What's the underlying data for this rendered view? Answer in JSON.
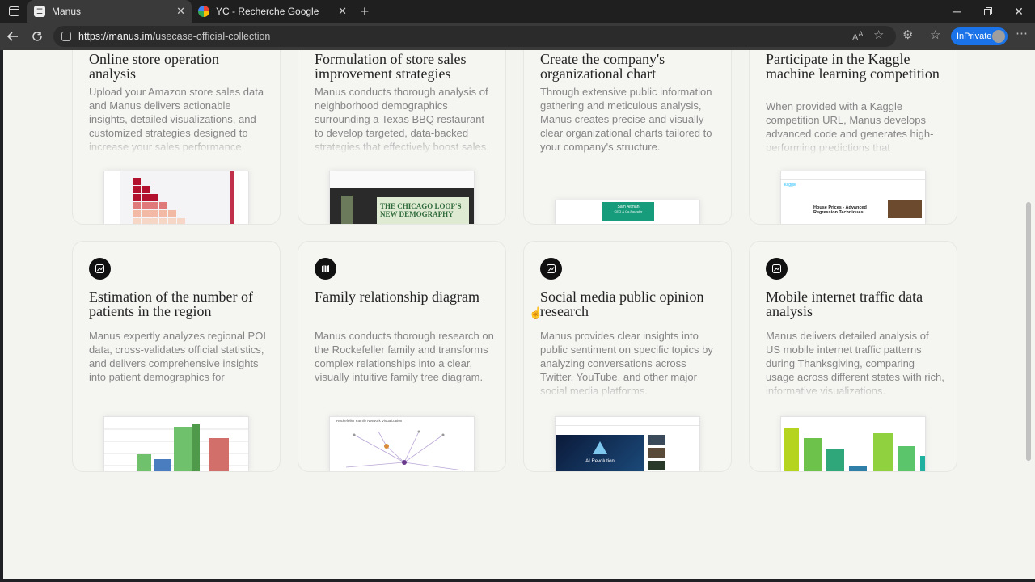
{
  "browser": {
    "tabs": [
      {
        "title": "Manus",
        "active": true
      },
      {
        "title": "YC - Recherche Google",
        "active": false
      }
    ],
    "url_domain": "https://manus.im",
    "url_path": "/usecase-official-collection",
    "inprivate_label": "InPrivate",
    "new_tab_symbol": "+"
  },
  "cards_row1": [
    {
      "title": "Online store operation analysis",
      "desc": "Upload your Amazon store sales data and Manus delivers actionable insights, detailed visualizations, and customized strategies designed to increase your sales performance.",
      "thumb": "heatmap-chart"
    },
    {
      "title": "Formulation of store sales improvement strategies",
      "desc": "Manus conducts thorough analysis of neighborhood demographics surrounding a Texas BBQ restaurant to develop targeted, data-backed strategies that effectively boost sales.",
      "thumb": "chicago-demography",
      "thumb_text": "THE CHICAGO LOOP'S NEW DEMOGRAPHY"
    },
    {
      "title": "Create the company's organizational chart",
      "desc": "Through extensive public information gathering and meticulous analysis, Manus creates precise and visually clear organizational charts tailored to your company's structure.",
      "thumb": "org-chart",
      "thumb_text": "Sam Altman",
      "thumb_subtext": "CEO & Co-Founder"
    },
    {
      "title": "Participate in the Kaggle machine learning competition",
      "desc": "When provided with a Kaggle competition URL, Manus develops advanced code and generates high-performing predictions that",
      "thumb": "kaggle-page",
      "thumb_text": "House Prices - Advanced Regression Techniques",
      "thumb_logo": "kaggle"
    }
  ],
  "cards_row2": [
    {
      "title": "Estimation of the number of patients in the region",
      "desc": "Manus expertly analyzes regional POI data, cross-validates official statistics, and delivers comprehensive insights into patient demographics for",
      "icon": "chart-icon",
      "thumb": "3d-bar-chart"
    },
    {
      "title": "Family relationship diagram",
      "desc": "Manus conducts thorough research on the Rockefeller family and transforms complex relationships into a clear, visually intuitive family tree diagram.",
      "icon": "map-icon",
      "thumb": "network-graph",
      "thumb_text": "Rockefeller Family Network Visualization"
    },
    {
      "title": "Social media public opinion research",
      "desc": "Manus provides clear insights into public sentiment on specific topics by analyzing conversations across Twitter, YouTube, and other major social media platforms.",
      "icon": "chart-icon",
      "thumb": "youtube-page",
      "thumb_text": "AI Revolution"
    },
    {
      "title": "Mobile internet traffic data analysis",
      "desc": "Manus delivers detailed analysis of US mobile internet traffic patterns during Thanksgiving, comparing usage across different states with rich, informative visualizations.",
      "icon": "chart-icon",
      "thumb": "bar-chart"
    }
  ],
  "colors": {
    "page_bg": "#f3f3ef",
    "card_bg": "#f5f5f2",
    "accent_blue": "#1a73e8"
  }
}
